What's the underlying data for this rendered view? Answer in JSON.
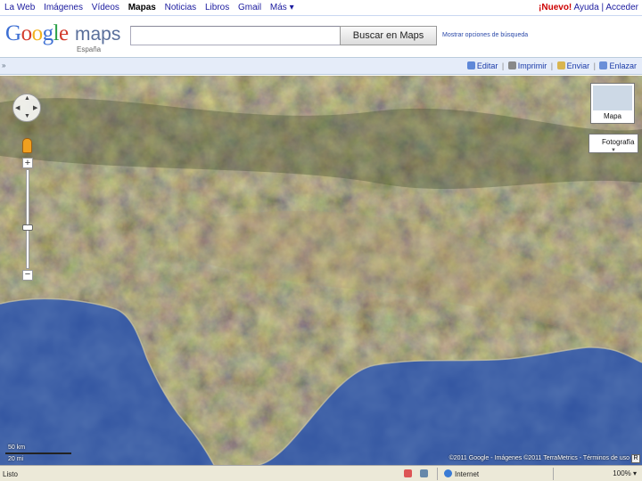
{
  "gbar": {
    "nav": [
      "La Web",
      "Imágenes",
      "Vídeos",
      "Mapas",
      "Noticias",
      "Libros",
      "Gmail",
      "Más ▾"
    ],
    "active": "Mapas",
    "new_label": "¡Nuevo!",
    "help_label": "Ayuda",
    "separator": "|",
    "login_label": "Acceder"
  },
  "header": {
    "logo_letters": [
      "G",
      "o",
      "o",
      "g",
      "l",
      "e"
    ],
    "logo_product": "maps",
    "logo_region": "España",
    "search_value": "",
    "search_button": "Buscar en Maps",
    "search_options": "Mostrar opciones de búsqueda"
  },
  "toolbar": {
    "collapse_icon": "»",
    "edit_label": "Editar",
    "print_label": "Imprimir",
    "send_label": "Enviar",
    "link_label": "Enlazar",
    "separator": "|"
  },
  "map": {
    "pan_arrows": {
      "up": "▲",
      "down": "▼",
      "left": "◀",
      "right": "▶"
    },
    "zoom_in_label": "+",
    "zoom_out_label": "−",
    "map_type_label": "Mapa",
    "photo_type_label": "Fotografía",
    "photo_chevron": "▼",
    "scale_km": "50 km",
    "scale_mi": "20 mi",
    "attribution": "©2011 Google - Imágenes ©2011 TerraMetrics - Términos de uso",
    "report_icon": "R",
    "colors": {
      "sea": "#2c4f9e",
      "land": "#6b6a3c",
      "land_light": "#a08a62",
      "land_dark": "#3e4a2a"
    }
  },
  "statusbar": {
    "left_text": "Listo",
    "zone_text": "Internet",
    "zoom_text": "100% ▾"
  }
}
